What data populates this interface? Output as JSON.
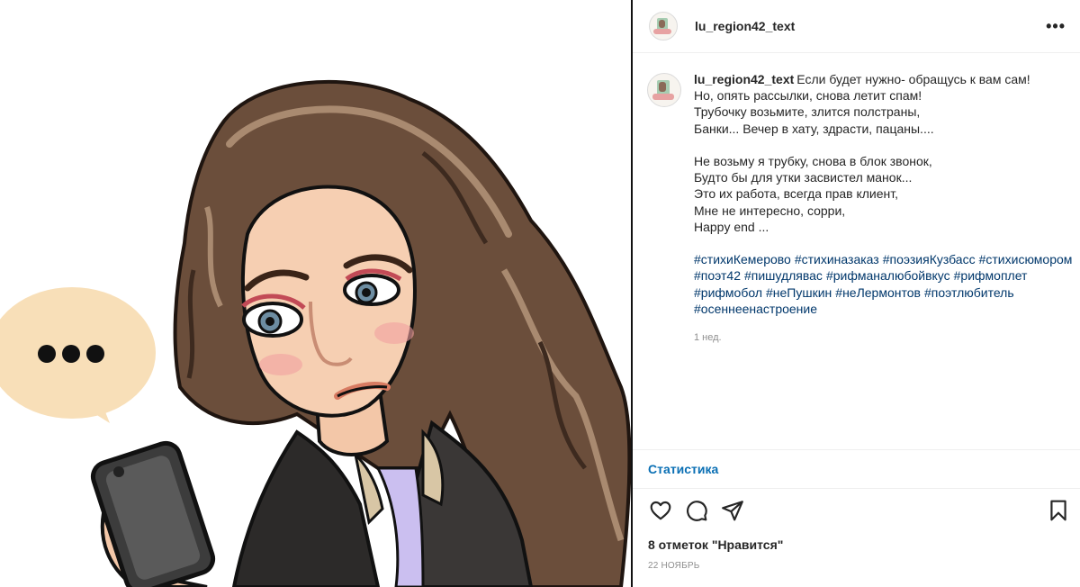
{
  "post": {
    "username": "lu_region42_text",
    "more_icon": "more-horizontal-icon",
    "caption_lines": [
      "Если будет нужно- обращусь к вам сам!",
      "Но, опять рассылки, снова летит спам!",
      "Трубочку возьмите, злится полстраны,",
      "Банки... Вечер в хату, здрасти, пацаны....",
      "Не возьму я трубку, снова в блок звонок,",
      "Будто бы для утки засвистел манок...",
      "Это их работа, всегда прав клиент,",
      "Мне не интересно, сорри,",
      "Happy end ..."
    ],
    "hashtags": [
      "#стихиКемерово",
      "#стихиназаказ",
      "#поэзияКузбасс",
      "#стихисюмором",
      "#поэт42",
      "#пишудлявас",
      "#рифманалюбойвкус",
      "#рифмоплет",
      "#рифмобол",
      "#неПушкин",
      "#неЛермонтов",
      "#поэтлюбитель",
      "#осеннеенастроение"
    ],
    "time_ago": "1 нед.",
    "stats_label": "Статистика",
    "likes_text": "8 отметок \"Нравится\"",
    "date": "22 НОЯБРЬ"
  },
  "icons": {
    "like": "heart-icon",
    "comment": "comment-icon",
    "share": "paper-plane-icon",
    "save": "bookmark-icon"
  },
  "colors": {
    "link": "#00376b",
    "stats": "#0a6fb4",
    "muted": "#8e8e8e",
    "text": "#262626"
  },
  "image": {
    "description_icon": "bitmoji-girl-with-phone-illustration",
    "bubble_text": "•••"
  }
}
